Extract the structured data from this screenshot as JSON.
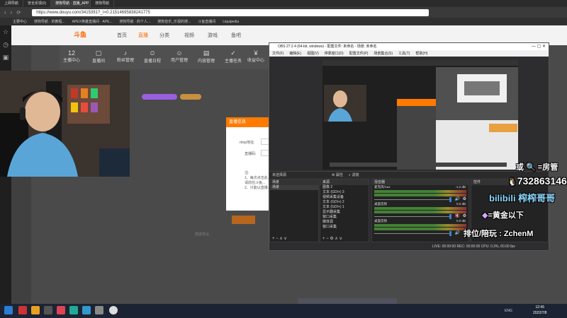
{
  "browser": {
    "tabs": [
      "上网导航",
      "安全反馈(0)",
      "搜狗导航 · 直播_APP",
      "搜狗导航"
    ],
    "url": "https://www.douyu.com/3415391?_r=0.21514695838241775",
    "bookmarks": [
      "主要中心",
      "搜狗导航 · 的教程...",
      "APEX英雄直播间 · APE...",
      "搜狗导航 · 的个人...",
      "搜狗音乐_乐视的搜...",
      "斗鱼直播间",
      "Liquipedia"
    ]
  },
  "douyu": {
    "logo": "斗鱼",
    "nav": [
      "首页",
      "直播",
      "分类",
      "视频",
      "游戏",
      "鱼吧"
    ],
    "iconbar": [
      {
        "label": "主播中心",
        "num": "12"
      },
      {
        "label": "直播间",
        "num": ""
      },
      {
        "label": "粉丝管理",
        "num": ""
      },
      {
        "label": "直播日程",
        "num": ""
      },
      {
        "label": "用户管理",
        "num": ""
      },
      {
        "label": "内容管理",
        "num": ""
      },
      {
        "label": "主播任务",
        "num": ""
      },
      {
        "label": "收益中心",
        "num": ""
      }
    ],
    "modal_title": "直播信息",
    "modal_fields": [
      "rtmp地址:",
      "直播码:"
    ],
    "modal_notes": [
      "注:",
      "1、每次点击此...",
      "请前往斗鱼...",
      "2、只能以直播..."
    ],
    "bottom_text": "您还可以"
  },
  "obs": {
    "title": "OBS 27.2.4 (64-bit, windows) - 配置文件: 未命名 - 场景: 未命名",
    "menu": [
      "文件(F)",
      "编辑(E)",
      "视图(V)",
      "停靠窗口(D)",
      "配置文件(P)",
      "场景集合(S)",
      "工具(T)",
      "帮助(H)"
    ],
    "no_source": "未选择源",
    "props_button": "属性",
    "filters_button": "滤镜",
    "panels": {
      "scenes": "场景",
      "sources": "来源",
      "mixer": "混音器",
      "controls": "控件"
    },
    "scenes": [
      "场景"
    ],
    "sources": [
      "图像 2",
      "文本 (GDI+) 3",
      "视频采集设备",
      "文本 (GDI+) 2",
      "文本 (GDI+) 1",
      "显示器采集",
      "窗口采集",
      "媒体源",
      "窗口采集"
    ],
    "mixer_channels": [
      {
        "name": "麦克风/Aux",
        "db": "-1.2 dB"
      },
      {
        "name": "桌面音频",
        "db": "0.0 dB"
      },
      {
        "name": "桌面音频",
        "db": "0.0 dB"
      }
    ],
    "controls": [
      "开始直播",
      "开始录制",
      "启动虚拟摄像机",
      "工作室模式",
      "设置",
      "退出"
    ],
    "status": "LIVE: 00:00:00   REC: 00:00:00   CPU: 0.3%, 60.00 fps"
  },
  "overlay": {
    "line1": "或 🔍 =房管",
    "qq": "732863146",
    "bili": "bilibili 榨榨哥哥",
    "tier": "=黄金以下",
    "ranking": "排位/陪玩  : ZchenM"
  },
  "taskbar": {
    "time": "12:45",
    "date": "2022/7/8",
    "lang": "ENG"
  },
  "colors": {
    "obs_bg": "#2d2d30",
    "douyu_orange": "#ff7a00",
    "page_bg": "#4a4a4a"
  }
}
